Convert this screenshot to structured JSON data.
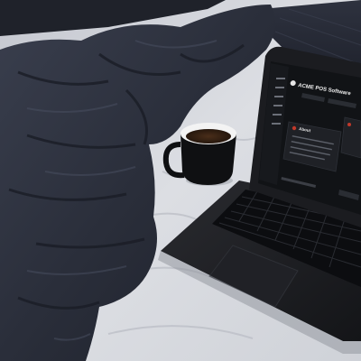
{
  "scene": {
    "laptop_screen": {
      "app_title": "ACME POS Software",
      "panel_heading": "About"
    }
  },
  "colors": {
    "sheet": "#d7d9de",
    "duvet": "#2b2f3b",
    "duvet_shadow": "#1a1d26",
    "laptop_body": "#1b1c20",
    "screen_bg": "#111316",
    "mug": "#0f1012",
    "coffee": "#3a2516",
    "accent_red": "#c0392b"
  }
}
